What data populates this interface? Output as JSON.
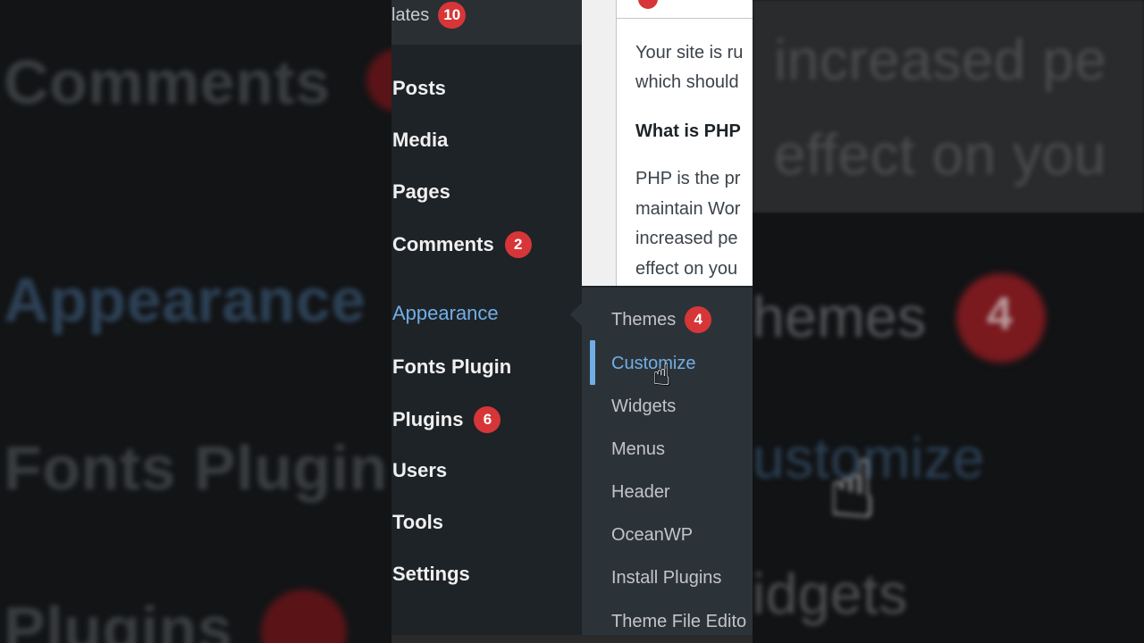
{
  "backdrop_left": {
    "comments": "Comments",
    "appearance": "Appearance",
    "fonts_plugin": "Fonts Plugin",
    "plugins": "Plugins",
    "plugins_count": "6"
  },
  "backdrop_right": {
    "line1": "increased pe",
    "line2": "effect on you",
    "themes": "hemes",
    "themes_count": "4",
    "customize": "ustomize",
    "widgets": "idgets"
  },
  "sidebar": {
    "updates_label": "lates",
    "updates_count": "10",
    "items": [
      {
        "label": "Posts"
      },
      {
        "label": "Media"
      },
      {
        "label": "Pages"
      },
      {
        "label": "Comments",
        "count": "2"
      },
      {
        "label": "Appearance"
      },
      {
        "label": "Fonts Plugin"
      },
      {
        "label": "Plugins",
        "count": "6"
      },
      {
        "label": "Users"
      },
      {
        "label": "Tools"
      },
      {
        "label": "Settings"
      }
    ]
  },
  "content": {
    "line1": "Your site is ru",
    "line2": "which should",
    "heading": "What is PHP",
    "p1": "PHP is the pr",
    "p2": "maintain Wor",
    "p3": "increased pe",
    "p4": "effect on you"
  },
  "submenu": {
    "items": [
      {
        "label": "Themes",
        "count": "4"
      },
      {
        "label": "Customize"
      },
      {
        "label": "Widgets"
      },
      {
        "label": "Menus"
      },
      {
        "label": "Header"
      },
      {
        "label": "OceanWP"
      },
      {
        "label": "Install Plugins"
      },
      {
        "label": "Theme File Edito"
      }
    ]
  },
  "colors": {
    "accent": "#72aee6",
    "badge": "#d63638",
    "sidebar_bg": "#1e2327",
    "submenu_bg": "#2c3338"
  },
  "icons": {
    "cursor": "hand-pointer-icon"
  }
}
